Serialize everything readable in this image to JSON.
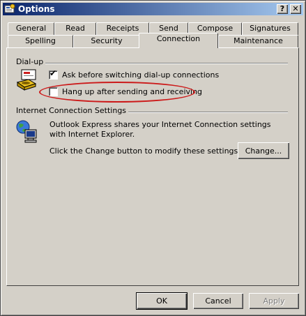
{
  "window": {
    "title": "Options",
    "help_button": "?",
    "close_button": "✕"
  },
  "tabs": {
    "row_back": [
      "General",
      "Read",
      "Receipts",
      "Send",
      "Compose",
      "Signatures"
    ],
    "row_front": [
      "Spelling",
      "Security",
      "Connection",
      "Maintenance"
    ],
    "active": "Connection"
  },
  "dialup": {
    "group_label": "Dial-up",
    "ask_before_switching": {
      "label": "Ask before switching dial-up connections",
      "checked": true
    },
    "hang_up_after_sending": {
      "label": "Hang up after sending and receiving",
      "checked": false
    }
  },
  "internet": {
    "group_label": "Internet Connection Settings",
    "description": "Outlook Express shares your Internet Connection settings with Internet Explorer.",
    "instruction": "Click the Change button to modify these settings.",
    "change_button": "Change..."
  },
  "footer": {
    "ok": "OK",
    "cancel": "Cancel",
    "apply": "Apply"
  },
  "colors": {
    "titlebar_start": "#0a246a",
    "titlebar_end": "#a6caf0",
    "annotation_oval": "#cc1a1a"
  }
}
